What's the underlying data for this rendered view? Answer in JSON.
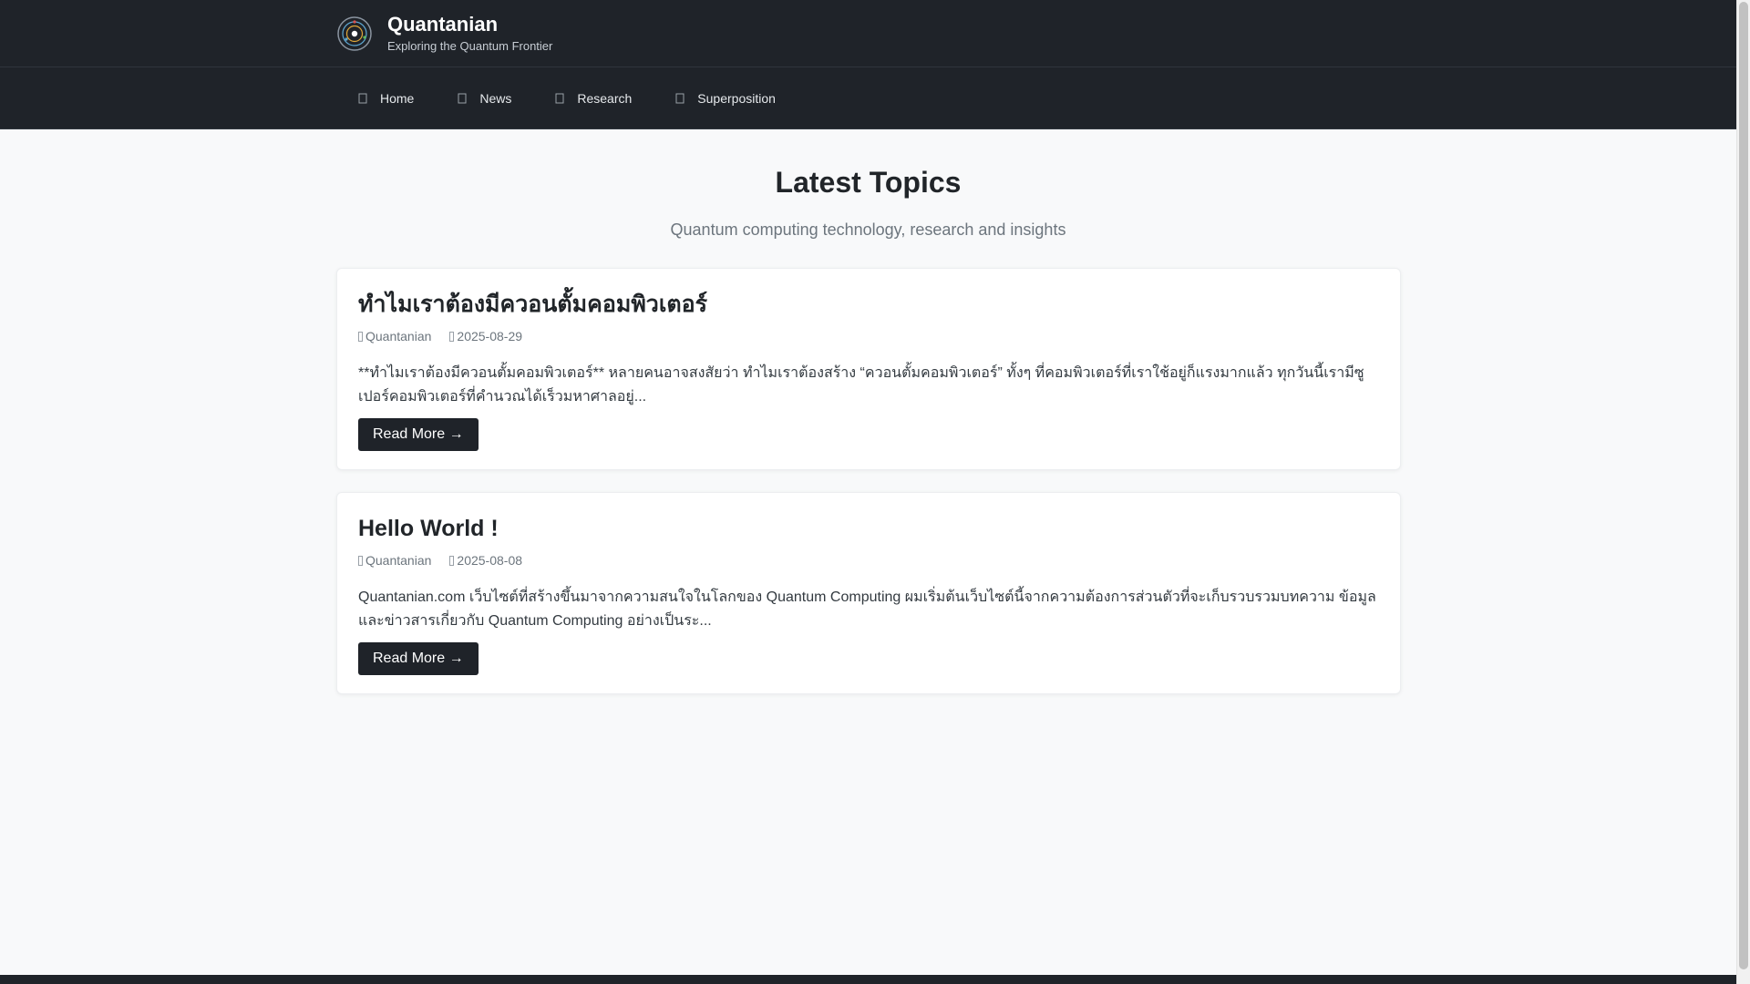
{
  "brand": {
    "name": "Quantanian",
    "tagline": "Exploring the Quantum Frontier",
    "logo_icon": "atom-logo-icon"
  },
  "nav": {
    "items": [
      {
        "label": "Home",
        "icon": "home-icon"
      },
      {
        "label": "News",
        "icon": "news-icon"
      },
      {
        "label": "Research",
        "icon": "research-icon"
      },
      {
        "label": "Superposition",
        "icon": "superposition-icon"
      }
    ]
  },
  "hero": {
    "title": "Latest Topics",
    "subtitle": "Quantum computing technology, research and insights"
  },
  "posts": [
    {
      "title": "ทำไมเราต้องมีควอนตั้มคอมพิวเตอร์",
      "author": "Quantanian",
      "date": "2025-08-29",
      "excerpt": "**ทำไมเราต้องมีควอนตั้มคอมพิวเตอร์** หลายคนอาจสงสัยว่า ทำไมเราต้องสร้าง “ควอนตั้มคอมพิวเตอร์” ทั้งๆ ที่คอมพิวเตอร์ที่เราใช้อยู่ก็แรงมากแล้ว ทุกวันนี้เรามีซูเปอร์คอมพิวเตอร์ที่คำนวณได้เร็วมหาศาลอยู่...",
      "read_more": "Read More →"
    },
    {
      "title": "Hello World !",
      "author": "Quantanian",
      "date": "2025-08-08",
      "excerpt": "Quantanian.com เว็บไซต์ที่สร้างขึ้นมาจากความสนใจในโลกของ Quantum Computing ผมเริ่มต้นเว็บไซต์นี้จากความต้องการส่วนตัวที่จะเก็บรวบรวมบทความ ข้อมูลและข่าวสารเกี่ยวกับ Quantum Computing อย่างเป็นระ...",
      "read_more": "Read More →"
    }
  ],
  "colors": {
    "header_bg": "#1f2329",
    "page_bg": "#f8f9fa",
    "button_bg": "#1f2329",
    "muted_text": "#6c757d"
  }
}
